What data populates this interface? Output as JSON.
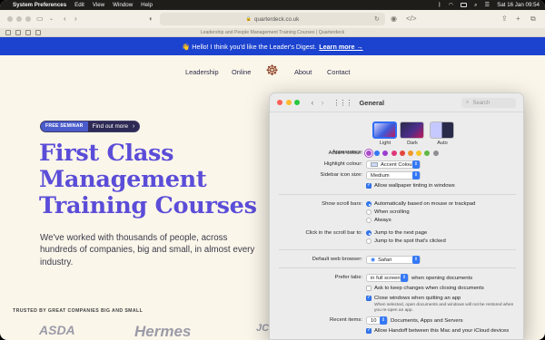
{
  "menubar": {
    "app_name": "System Preferences",
    "items": [
      "Edit",
      "View",
      "Window",
      "Help"
    ],
    "clock": "Sat 16 Jan  09:54"
  },
  "browser": {
    "url": "quarterdeck.co.uk",
    "tab_title": "Leadership and People Management Training Courses | Quarterdeck"
  },
  "banner": {
    "text": "👋 Hello! I think you'd like the Leader's Digest.",
    "link": "Learn more →"
  },
  "site_nav": {
    "items": [
      "Leadership",
      "Online",
      "About",
      "Contact"
    ]
  },
  "hero": {
    "badge": "FREE SEMINAR",
    "badge_link": "Find out more",
    "title_lines": [
      "First Class",
      "Management",
      "Training Courses"
    ],
    "subtitle": "We've worked with thousands of people, across hundreds of companies, big and small, in almost every industry.",
    "trusted_label": "TRUSTED BY GREAT COMPANIES BIG AND SMALL",
    "logos": [
      "ASDA",
      "Hermes",
      "JCT"
    ]
  },
  "prefs": {
    "title": "General",
    "search_placeholder": "Search",
    "appearance_label": "Appearance:",
    "appearance_options": [
      "Light",
      "Dark",
      "Auto"
    ],
    "appearance_selected": "Light",
    "accent_label": "Accent colour:",
    "accent_colors": [
      "#a94ac9",
      "#3478f6",
      "#9b3dd1",
      "#e0387a",
      "#e2453c",
      "#f0962c",
      "#f7c627",
      "#5fb845",
      "#8e8e93"
    ],
    "highlight_label": "Highlight colour:",
    "highlight_value": "Accent Colour",
    "sidebar_label": "Sidebar icon size:",
    "sidebar_value": "Medium",
    "wallpaper_tint": "Allow wallpaper tinting in windows",
    "scroll_label": "Show scroll bars:",
    "scroll_options": [
      "Automatically based on mouse or trackpad",
      "When scrolling",
      "Always"
    ],
    "click_label": "Click in the scroll bar to:",
    "click_options": [
      "Jump to the next page",
      "Jump to the spot that's clicked"
    ],
    "browser_label": "Default web browser:",
    "browser_value": "Safari",
    "prefer_tabs_label": "Prefer tabs:",
    "prefer_tabs_value": "in full screen",
    "prefer_tabs_suffix": "when opening documents",
    "ask_keep": "Ask to keep changes when closing documents",
    "close_windows": "Close windows when quitting an app",
    "close_windows_note": "When selected, open documents and windows will not be restored when you re-open an app.",
    "recent_label": "Recent items:",
    "recent_value": "10",
    "recent_suffix": "Documents, Apps and Servers",
    "handoff": "Allow Handoff between this Mac and your iCloud devices"
  }
}
